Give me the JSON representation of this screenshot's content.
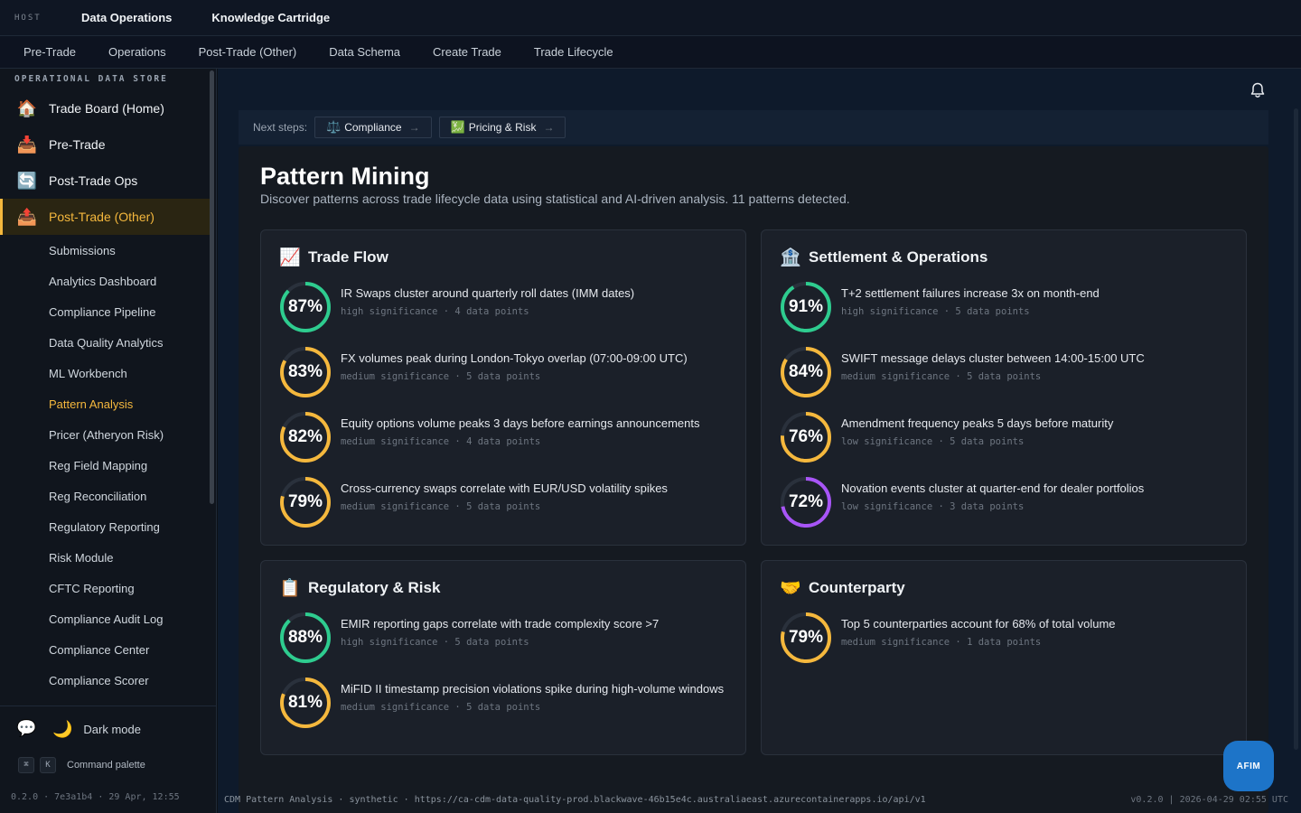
{
  "topbar": {
    "host_label": "HOST",
    "links": [
      "Data Operations",
      "Knowledge Cartridge"
    ]
  },
  "subnav": [
    "Pre-Trade",
    "Operations",
    "Post-Trade (Other)",
    "Data Schema",
    "Create Trade",
    "Trade Lifecycle"
  ],
  "sidebar": {
    "heading": "OPERATIONAL DATA STORE",
    "items": [
      {
        "label": "Trade Board (Home)",
        "icon": "house-icon",
        "glyph": "🏠"
      },
      {
        "label": "Pre-Trade",
        "icon": "inbox-tray-icon",
        "glyph": "📥"
      },
      {
        "label": "Post-Trade Ops",
        "icon": "refresh-icon",
        "glyph": "🔄"
      },
      {
        "label": "Post-Trade (Other)",
        "icon": "outbox-tray-icon",
        "glyph": "📤",
        "active": true
      }
    ],
    "subitems": [
      "Submissions",
      "Analytics Dashboard",
      "Compliance Pipeline",
      "Data Quality Analytics",
      "ML Workbench",
      "Pattern Analysis",
      "Pricer (Atheryon Risk)",
      "Reg Field Mapping",
      "Reg Reconciliation",
      "Regulatory Reporting",
      "Risk Module",
      "CFTC Reporting",
      "Compliance Audit Log",
      "Compliance Center",
      "Compliance Scorer"
    ],
    "active_subitem": "Pattern Analysis",
    "dark_mode_label": "Dark mode",
    "cmd_key1": "⌘",
    "cmd_key2": "K",
    "command_palette_label": "Command palette",
    "version": "0.2.0 · 7e3a1b4 · 29 Apr, 12:55"
  },
  "next_steps": {
    "label": "Next steps:",
    "buttons": [
      {
        "label": "Compliance",
        "icon": "scales-icon",
        "glyph": "⚖️"
      },
      {
        "label": "Pricing & Risk",
        "icon": "chart-exchange-icon",
        "glyph": "💹"
      }
    ]
  },
  "page": {
    "title": "Pattern Mining",
    "subtitle": "Discover patterns across trade lifecycle data using statistical and AI-driven analysis. 11 patterns detected."
  },
  "colors": {
    "high": "#2ecc8f",
    "medium": "#f5b83d",
    "low": "#a855f7",
    "track": "#2a313c"
  },
  "cards": [
    {
      "title": "Trade Flow",
      "icon": "chart-up-icon",
      "glyph": "📈",
      "patterns": [
        {
          "pct": "87%",
          "value": 0.87,
          "level": "high",
          "text": "IR Swaps cluster around quarterly roll dates (IMM dates)",
          "meta": "high significance · 4 data points"
        },
        {
          "pct": "83%",
          "value": 0.83,
          "level": "medium",
          "text": "FX volumes peak during London-Tokyo overlap (07:00-09:00 UTC)",
          "meta": "medium significance · 5 data points"
        },
        {
          "pct": "82%",
          "value": 0.82,
          "level": "medium",
          "text": "Equity options volume peaks 3 days before earnings announcements",
          "meta": "medium significance · 4 data points"
        },
        {
          "pct": "79%",
          "value": 0.79,
          "level": "medium",
          "text": "Cross-currency swaps correlate with EUR/USD volatility spikes",
          "meta": "medium significance · 5 data points"
        }
      ]
    },
    {
      "title": "Settlement & Operations",
      "icon": "bank-icon",
      "glyph": "🏦",
      "patterns": [
        {
          "pct": "91%",
          "value": 0.91,
          "level": "high",
          "text": "T+2 settlement failures increase 3x on month-end",
          "meta": "high significance · 5 data points"
        },
        {
          "pct": "84%",
          "value": 0.84,
          "level": "medium",
          "text": "SWIFT message delays cluster between 14:00-15:00 UTC",
          "meta": "medium significance · 5 data points"
        },
        {
          "pct": "76%",
          "value": 0.76,
          "level": "medium",
          "text": "Amendment frequency peaks 5 days before maturity",
          "meta": "low significance · 5 data points"
        },
        {
          "pct": "72%",
          "value": 0.72,
          "level": "low",
          "text": "Novation events cluster at quarter-end for dealer portfolios",
          "meta": "low significance · 3 data points"
        }
      ]
    },
    {
      "title": "Regulatory & Risk",
      "icon": "clipboard-icon",
      "glyph": "📋",
      "patterns": [
        {
          "pct": "88%",
          "value": 0.88,
          "level": "high",
          "text": "EMIR reporting gaps correlate with trade complexity score >7",
          "meta": "high significance · 5 data points"
        },
        {
          "pct": "81%",
          "value": 0.81,
          "level": "medium",
          "text": "MiFID II timestamp precision violations spike during high-volume windows",
          "meta": "medium significance · 5 data points"
        }
      ]
    },
    {
      "title": "Counterparty",
      "icon": "handshake-icon",
      "glyph": "🤝",
      "patterns": [
        {
          "pct": "79%",
          "value": 0.79,
          "level": "medium",
          "text": "Top 5 counterparties account for 68% of total volume",
          "meta": "medium significance · 1 data points"
        }
      ]
    }
  ],
  "footer": {
    "left": "CDM Pattern Analysis · synthetic · https://ca-cdm-data-quality-prod.blackwave-46b15e4c.australiaeast.azurecontainerapps.io/api/v1",
    "right": "v0.2.0 | 2026-04-29 02:55 UTC"
  },
  "afim_label": "AFIM"
}
